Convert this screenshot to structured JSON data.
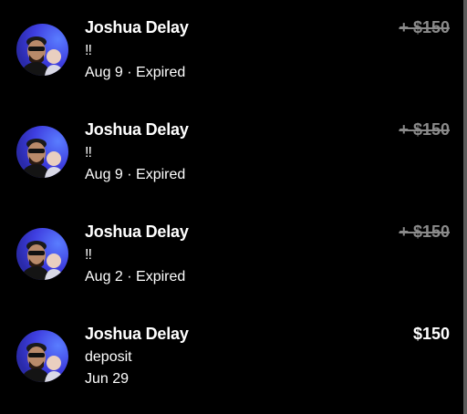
{
  "transactions": [
    {
      "name": "Joshua Delay",
      "memo": "‼",
      "meta": "Aug 9 · Expired",
      "amount": "+ $150",
      "expired": true
    },
    {
      "name": "Joshua Delay",
      "memo": "‼",
      "meta": "Aug 9 · Expired",
      "amount": "+ $150",
      "expired": true
    },
    {
      "name": "Joshua Delay",
      "memo": "‼",
      "meta": "Aug 2 · Expired",
      "amount": "+ $150",
      "expired": true
    },
    {
      "name": "Joshua Delay",
      "memo": "deposit",
      "meta": "Jun 29",
      "amount": "$150",
      "expired": false
    }
  ],
  "colors": {
    "background": "#000000",
    "text": "#ffffff",
    "expired_amount": "#8a8a8a",
    "avatar_bg": "#3e3ee0",
    "scrollbar": "#5a5a5a"
  }
}
